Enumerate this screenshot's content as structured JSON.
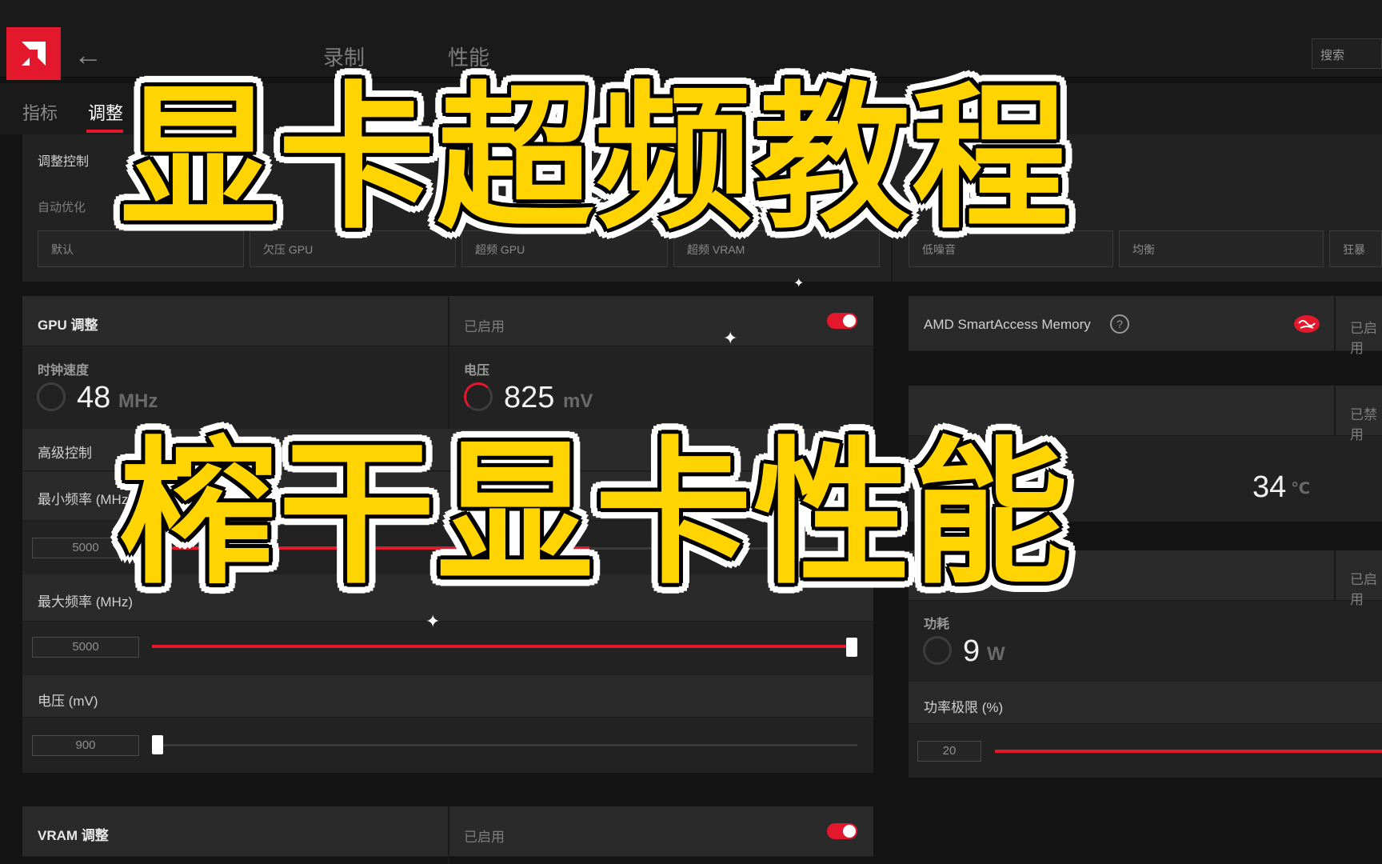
{
  "header": {
    "nav_record": "录制",
    "nav_performance": "性能",
    "search_label": "搜索"
  },
  "tabs": [
    {
      "label": "指标"
    },
    {
      "label": "调整"
    }
  ],
  "tuning_control": {
    "title": "调整控制",
    "auto_optimize": "自动优化",
    "presets_left": [
      "默认",
      "欠压 GPU",
      "超频 GPU",
      "超频 VRAM"
    ],
    "presets_right": [
      "低噪音",
      "均衡",
      "狂暴"
    ]
  },
  "gpu_tuning": {
    "title": "GPU 调整",
    "status": "已启用",
    "clock_label": "时钟速度",
    "clock_value": "48",
    "clock_unit": "MHz",
    "voltage_label": "电压",
    "voltage_value": "825",
    "voltage_unit": "mV",
    "advanced_label": "高级控制",
    "advanced_status": "已启用",
    "min_freq_label": "最小频率 (MHz)",
    "min_freq_value": "5000",
    "max_freq_label": "最大频率 (MHz)",
    "max_freq_value": "5000",
    "voltage_mv_label": "电压 (mV)",
    "voltage_mv_value": "900"
  },
  "vram_tuning": {
    "title": "VRAM 调整",
    "status": "已启用"
  },
  "right_panel": {
    "sam_label": "AMD SmartAccess Memory",
    "sam_status": "已启用",
    "fan_status": "已禁用",
    "temp_value": "34",
    "temp_unit": "℃",
    "power_status": "已启用",
    "power_label": "功耗",
    "power_value": "9",
    "power_unit": "W",
    "power_limit_label": "功率极限 (%)",
    "power_limit_value": "20"
  },
  "slider_levels": {
    "min_freq_fraction": 0.62,
    "max_freq_fraction": 1.0,
    "voltage_fraction": 0.0,
    "power_limit_fraction": 1.0
  },
  "overlay": {
    "line1": "显卡超频教程",
    "line2": "榨干显卡性能"
  },
  "colors": {
    "accent": "#e3182d",
    "overlay_text": "#ffd400"
  }
}
